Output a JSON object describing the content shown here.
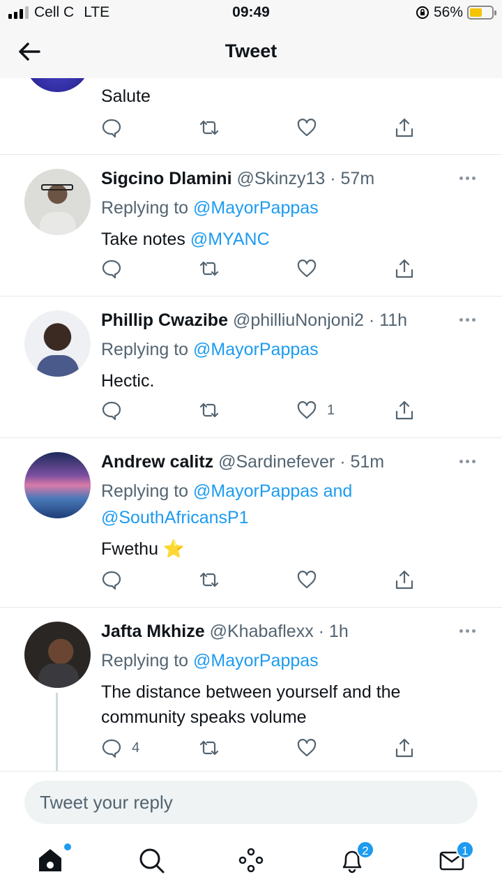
{
  "status_bar": {
    "carrier": "Cell C",
    "network": "LTE",
    "time": "09:49",
    "battery": "56%",
    "battery_level": 0.56
  },
  "header": {
    "title": "Tweet"
  },
  "tweets": [
    {
      "name": "",
      "handle": "",
      "time": "",
      "reply_prefix": "",
      "reply_handle": "",
      "body": "Salute",
      "likes": "",
      "replies": ""
    },
    {
      "name": "Sigcino Dlamini",
      "handle": "@Skinzy13",
      "time": "57m",
      "reply_prefix": "Replying to ",
      "reply_handle": "@MayorPappas",
      "body": "Take notes ",
      "body_mention": "@MYANC",
      "likes": "",
      "replies": ""
    },
    {
      "name": "Phillip Cwazibe",
      "handle": "@philliuNonjoni2",
      "time": "11h",
      "reply_prefix": "Replying to ",
      "reply_handle": "@MayorPappas",
      "body": "Hectic.",
      "likes": "1",
      "replies": ""
    },
    {
      "name": "Andrew calitz",
      "handle": "@Sardinefever",
      "time": "51m",
      "reply_prefix": "Replying to ",
      "reply_handle": "@MayorPappas and @SouthAfricansP1",
      "body": "Fwethu ⭐",
      "likes": "",
      "replies": ""
    },
    {
      "name": "Jafta Mkhize",
      "handle": "@Khabaflexx",
      "time": "1h",
      "reply_prefix": "Replying to ",
      "reply_handle": "@MayorPappas",
      "body": "The distance between yourself and the community speaks volume",
      "likes": "",
      "replies": "4"
    }
  ],
  "sep": " · ",
  "reply_box": {
    "placeholder": "Tweet your reply"
  },
  "tabbar": {
    "notifications_badge": "2",
    "messages_badge": "1"
  },
  "colors": {
    "accent": "#1d9bf0",
    "text": "#0f1419",
    "muted": "#536471"
  }
}
